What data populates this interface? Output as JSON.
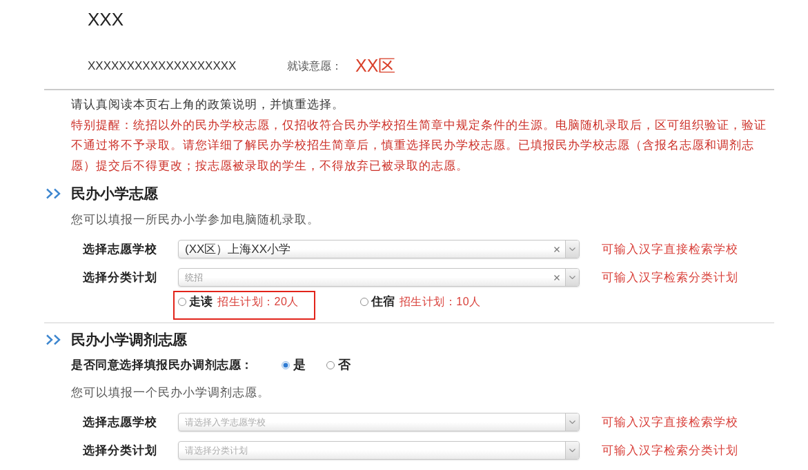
{
  "header": {
    "title": "XXX",
    "name": "XXXXXXXXXXXXXXXXXXX",
    "district_label": "就读意愿：",
    "district": "XX区"
  },
  "notice": {
    "intro": "请认真阅读本页右上角的政策说明，并慎重选择。",
    "warning": "特别提醒：统招以外的民办学校志愿，仅招收符合民办学校招生简章中规定条件的生源。电脑随机录取后，区可组织验证，验证不通过将不予录取。请您详细了解民办学校招生简章后，慎重选择民办学校志愿。已填报民办学校志愿（含报名志愿和调剂志愿）提交后不得更改；按志愿被录取的学生，不得放弃已被录取的志愿。"
  },
  "sections": [
    {
      "heading": "民办小学志愿",
      "description": "您可以填报一所民办小学参加电脑随机录取。",
      "fields": [
        {
          "label": "选择志愿学校",
          "value": "(XX区）上海XX小学",
          "dimmed": false,
          "clearable": true,
          "hint": "可输入汉字直接检索学校"
        },
        {
          "label": "选择分类计划",
          "value": "统招",
          "dimmed": true,
          "clearable": true,
          "hint": "可输入汉字检索分类计划"
        }
      ],
      "plan_options": [
        {
          "label": "走读",
          "quota": "招生计划：20人",
          "selected": false,
          "highlighted": true
        },
        {
          "label": "住宿",
          "quota": "招生计划：10人",
          "selected": false,
          "highlighted": false
        }
      ]
    },
    {
      "heading": "民办小学调剂志愿",
      "consent": {
        "question": "是否同意选择填报民办调剂志愿：",
        "options": [
          {
            "label": "是",
            "selected": true
          },
          {
            "label": "否",
            "selected": false
          }
        ]
      },
      "description": "您可以填报一个民办小学调剂志愿。",
      "fields": [
        {
          "label": "选择志愿学校",
          "placeholder": "请选择入学志愿学校",
          "clearable": false,
          "hint": "可输入汉字直接检索学校"
        },
        {
          "label": "选择分类计划",
          "placeholder": "请选择分类计划",
          "clearable": false,
          "hint": "可输入汉字检索分类计划"
        }
      ]
    }
  ]
}
